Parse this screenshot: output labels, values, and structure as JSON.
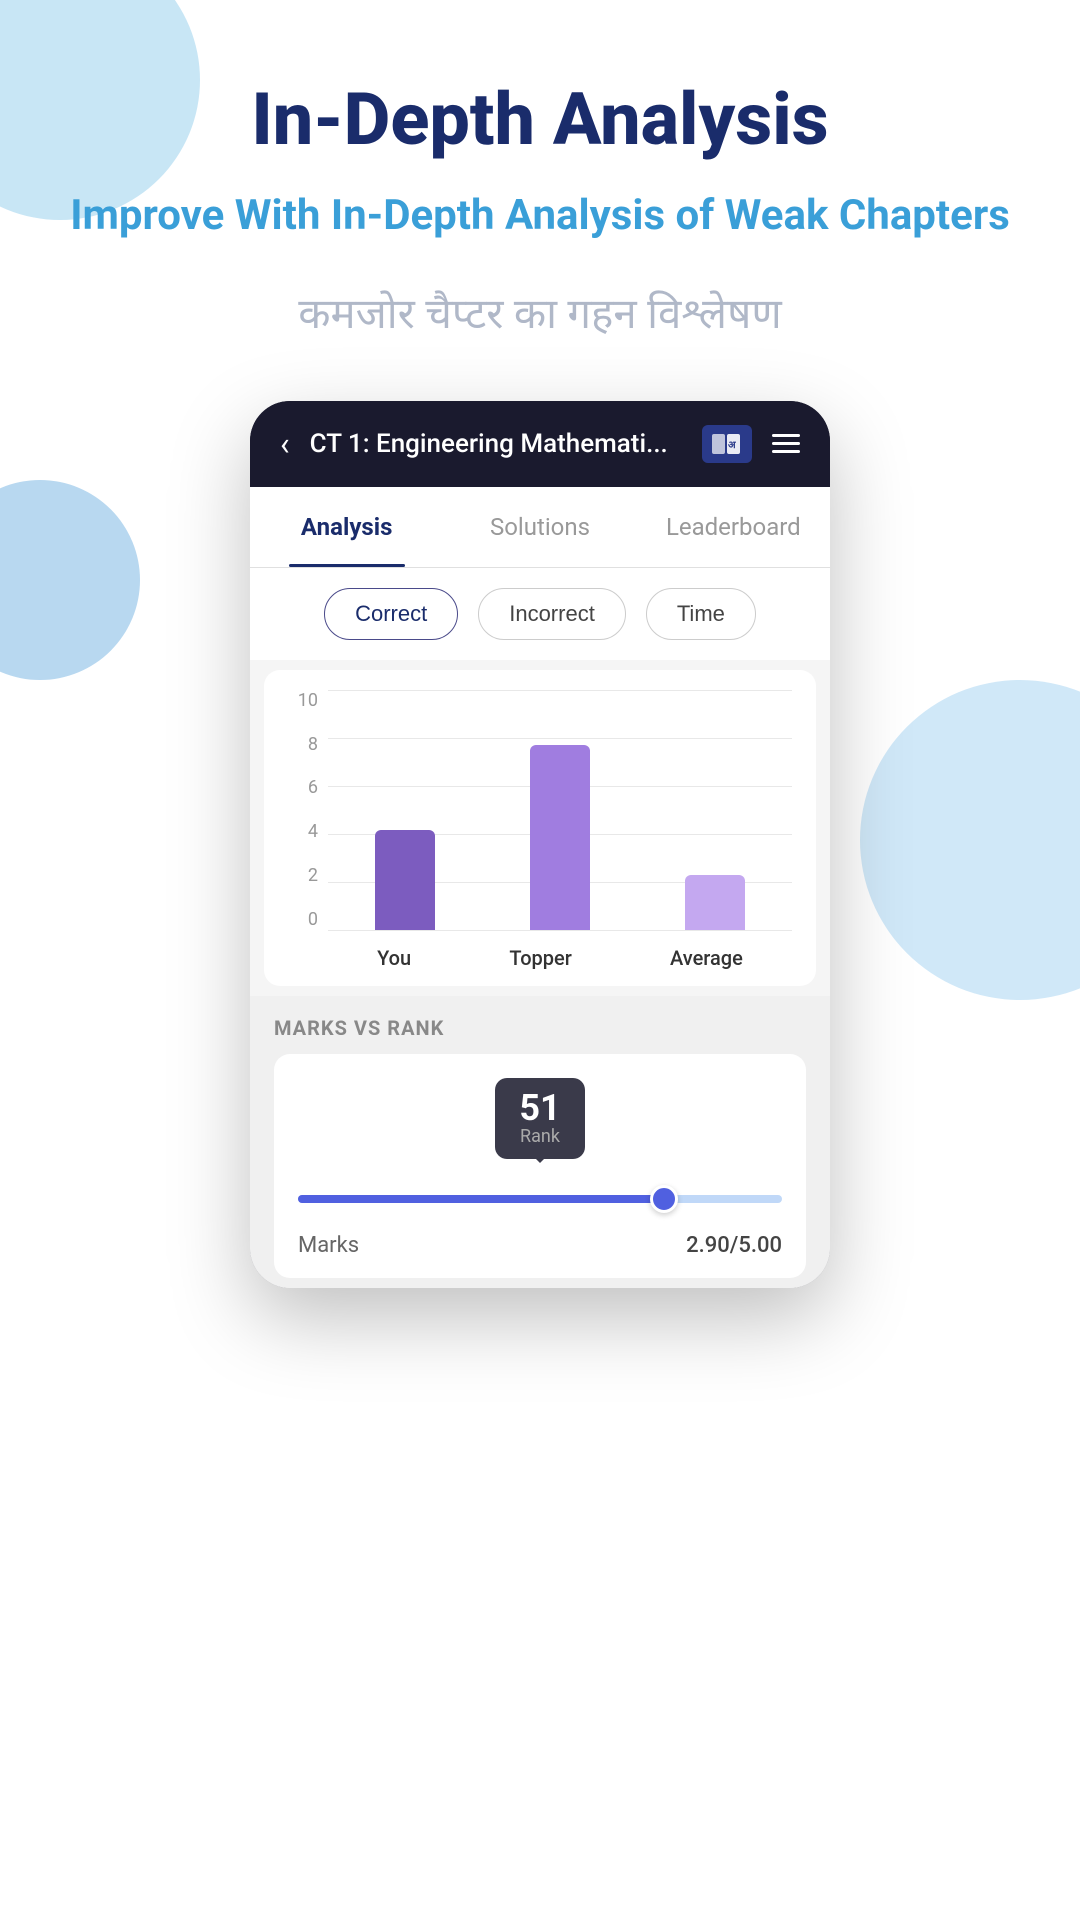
{
  "page": {
    "main_title": "In-Depth Analysis",
    "subtitle": "Improve With In-Depth Analysis of Weak Chapters",
    "hindi_text": "कमजोर चैप्टर का गहन विश्लेषण"
  },
  "phone": {
    "header": {
      "back_icon": "‹",
      "title": "CT 1: Engineering Mathemati...",
      "menu_icon": "≡"
    },
    "tabs": [
      {
        "label": "Analysis",
        "active": true
      },
      {
        "label": "Solutions",
        "active": false
      },
      {
        "label": "Leaderboard",
        "active": false
      }
    ],
    "filters": [
      {
        "label": "Correct",
        "active": true
      },
      {
        "label": "Incorrect",
        "active": false
      },
      {
        "label": "Time",
        "active": false
      }
    ],
    "chart": {
      "y_axis": [
        "10",
        "8",
        "6",
        "4",
        "2",
        "0"
      ],
      "bars": [
        {
          "label": "You",
          "height_pct": 54
        },
        {
          "label": "Topper",
          "height_pct": 100
        },
        {
          "label": "Average",
          "height_pct": 30
        }
      ]
    },
    "marks_rank": {
      "section_title": "MARKS VS RANK",
      "rank_number": "51",
      "rank_label": "Rank",
      "slider_pct": 76,
      "marks_label": "Marks",
      "marks_value": "2.90/5.00"
    }
  }
}
